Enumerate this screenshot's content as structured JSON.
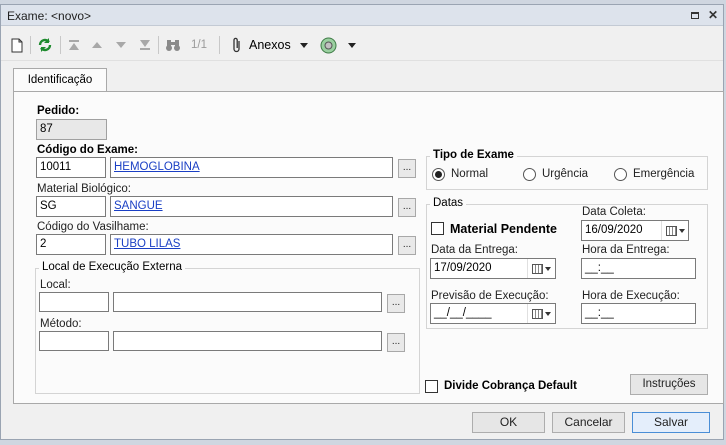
{
  "window": {
    "title": "Exame: <novo>"
  },
  "toolbar": {
    "page_indicator": "1/1",
    "anexos_label": "Anexos"
  },
  "tabs": [
    {
      "label": "Identificação"
    }
  ],
  "form": {
    "pedido": {
      "label": "Pedido:",
      "value": "87"
    },
    "codigo_exame": {
      "label": "Código do Exame:",
      "code": "10011",
      "name": "HEMOGLOBINA"
    },
    "material": {
      "label": "Material Biológico:",
      "code": "SG",
      "name": "SANGUE"
    },
    "vasilhame": {
      "label": "Código do Vasilhame:",
      "code": "2",
      "name": "TUBO LILAS"
    },
    "local_execucao": {
      "group_title": "Local de Execução Externa",
      "local_label": "Local:",
      "local_code": "",
      "local_name": "",
      "metodo_label": "Método:",
      "metodo_code": "",
      "metodo_name": ""
    },
    "tipo_exame": {
      "group_title": "Tipo de Exame",
      "options": [
        "Normal",
        "Urgência",
        "Emergência"
      ],
      "selected": "Normal"
    },
    "datas": {
      "group_title": "Datas",
      "material_pendente": "Material Pendente",
      "material_pendente_checked": false,
      "data_coleta_label": "Data Coleta:",
      "data_coleta": "16/09/2020",
      "data_entrega_label": "Data da Entrega:",
      "data_entrega": "17/09/2020",
      "hora_entrega_label": "Hora da Entrega:",
      "hora_entrega": "__:__",
      "previsao_label": "Previsão de Execução:",
      "previsao": "__/__/____",
      "hora_execucao_label": "Hora de Execução:",
      "hora_execucao": "__:__"
    },
    "divide_cobranca": {
      "label": "Divide Cobrança Default",
      "checked": false
    },
    "instrucoes_label": "Instruções"
  },
  "buttons": {
    "ok": "OK",
    "cancelar": "Cancelar",
    "salvar": "Salvar"
  },
  "colors": {
    "link": "#1a3fc4",
    "primary_border": "#4a8ed6"
  }
}
